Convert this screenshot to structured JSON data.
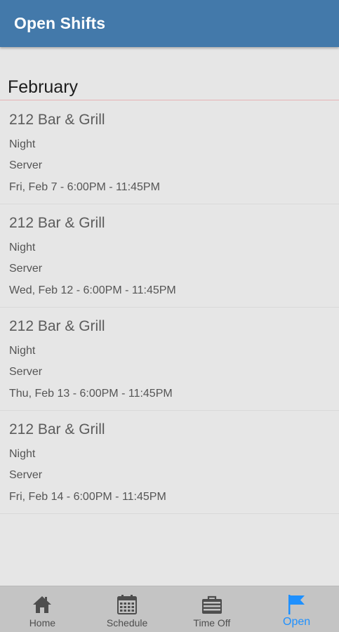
{
  "header": {
    "title": "Open Shifts"
  },
  "section": {
    "title": "February"
  },
  "shifts": [
    {
      "venue": "212 Bar & Grill",
      "period": "Night",
      "role": "Server",
      "time": "Fri, Feb 7 - 6:00PM - 11:45PM"
    },
    {
      "venue": "212 Bar & Grill",
      "period": "Night",
      "role": "Server",
      "time": "Wed, Feb 12 - 6:00PM - 11:45PM"
    },
    {
      "venue": "212 Bar & Grill",
      "period": "Night",
      "role": "Server",
      "time": "Thu, Feb 13 - 6:00PM - 11:45PM"
    },
    {
      "venue": "212 Bar & Grill",
      "period": "Night",
      "role": "Server",
      "time": "Fri, Feb 14 - 6:00PM - 11:45PM"
    }
  ],
  "tabs": [
    {
      "label": "Home",
      "icon": "home-icon"
    },
    {
      "label": "Schedule",
      "icon": "calendar-icon"
    },
    {
      "label": "Time Off",
      "icon": "briefcase-icon"
    },
    {
      "label": "Open",
      "icon": "flag-icon",
      "active": true
    }
  ],
  "colors": {
    "header": "#4379aa",
    "active_tab": "#1e90ff",
    "inactive_icon": "#4e4e4e",
    "tab_bar": "#c4c4c4",
    "section_divider": "#e7b1b5"
  }
}
